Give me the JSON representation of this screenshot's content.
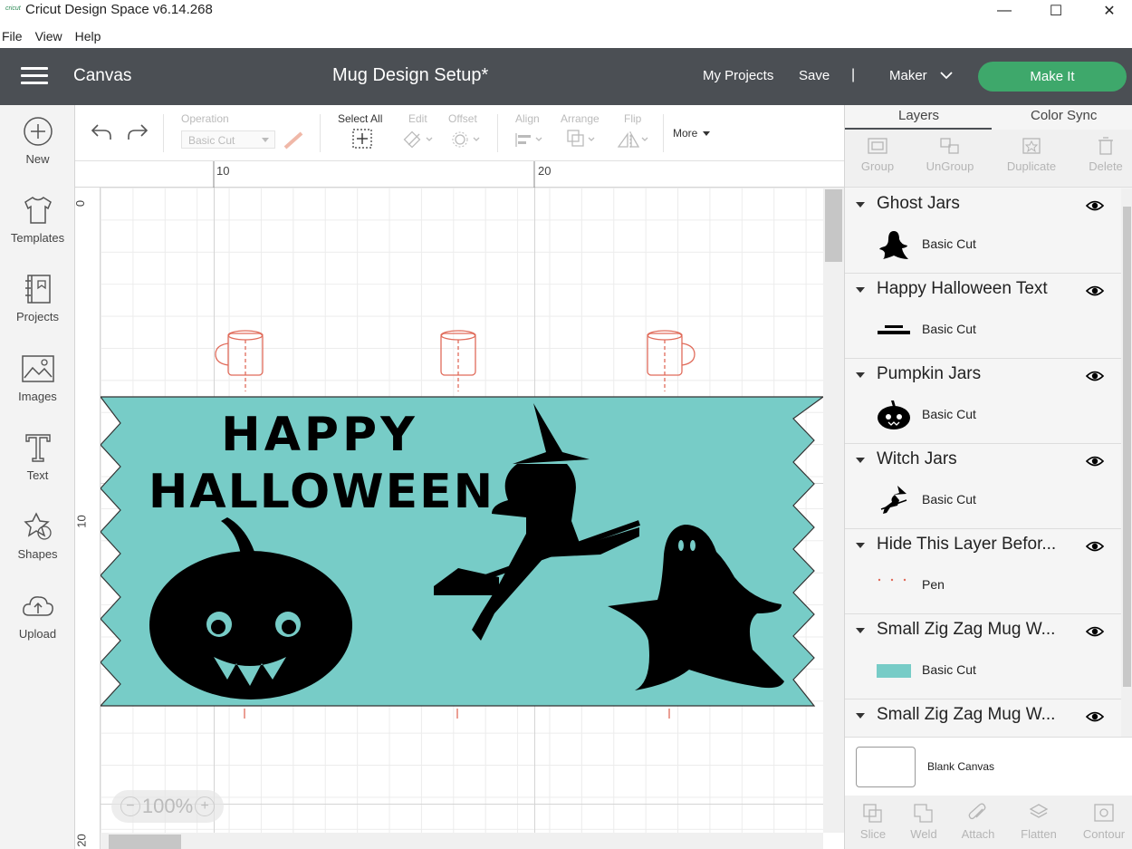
{
  "window": {
    "app_logo": "cricut",
    "title": "Cricut Design Space  v6.14.268",
    "controls": {
      "minimize": "—",
      "maximize": "☐",
      "close": "✕"
    }
  },
  "menu": [
    "File",
    "View",
    "Help"
  ],
  "header": {
    "section": "Canvas",
    "project_title": "Mug Design Setup*",
    "my_projects": "My Projects",
    "save": "Save",
    "separator": "|",
    "machine": "Maker",
    "make_it": "Make It",
    "make_it_color": "#3ea86b",
    "header_color": "#4b4f54"
  },
  "sidebar": {
    "items": [
      {
        "label": "New",
        "icon": "plus-circle-icon"
      },
      {
        "label": "Templates",
        "icon": "tshirt-icon"
      },
      {
        "label": "Projects",
        "icon": "notebook-icon"
      },
      {
        "label": "Images",
        "icon": "image-icon"
      },
      {
        "label": "Text",
        "icon": "text-t-icon"
      },
      {
        "label": "Shapes",
        "icon": "shapes-icon"
      },
      {
        "label": "Upload",
        "icon": "cloud-upload-icon"
      }
    ]
  },
  "toolbar": {
    "undo_icon": "undo-icon",
    "redo_icon": "redo-icon",
    "operation_label": "Operation",
    "operation_value": "Basic Cut",
    "select_all": "Select All",
    "edit": "Edit",
    "offset": "Offset",
    "align": "Align",
    "arrange": "Arrange",
    "flip": "Flip",
    "more": "More"
  },
  "rulers": {
    "top": [
      "10",
      "20"
    ],
    "left": [
      "0",
      "10",
      "20"
    ]
  },
  "canvas": {
    "zoom": "100%",
    "zoom_minus": "−",
    "zoom_plus": "+",
    "banner_color": "#77ccc7",
    "design_text_line1": "HAPPY",
    "design_text_line2": "HALLOWEEN"
  },
  "right_panel": {
    "tabs": [
      "Layers",
      "Color Sync"
    ],
    "actions": [
      "Group",
      "UnGroup",
      "Duplicate",
      "Delete"
    ],
    "layers": [
      {
        "name": "Ghost Jars",
        "operation": "Basic Cut",
        "thumb": "ghost"
      },
      {
        "name": "Happy Halloween Text",
        "operation": "Basic Cut",
        "thumb": "text"
      },
      {
        "name": "Pumpkin Jars",
        "operation": "Basic Cut",
        "thumb": "pumpkin"
      },
      {
        "name": "Witch Jars",
        "operation": "Basic Cut",
        "thumb": "witch"
      },
      {
        "name": "Hide This Layer Befor...",
        "operation": "Pen",
        "thumb": "pen"
      },
      {
        "name": "Small Zig Zag Mug W...",
        "operation": "Basic Cut",
        "thumb": "swatch"
      },
      {
        "name": "Small Zig Zag Mug W...",
        "operation": "",
        "thumb": ""
      }
    ],
    "blank_canvas": "Blank Canvas",
    "bottom_actions": [
      "Slice",
      "Weld",
      "Attach",
      "Flatten",
      "Contour"
    ]
  }
}
